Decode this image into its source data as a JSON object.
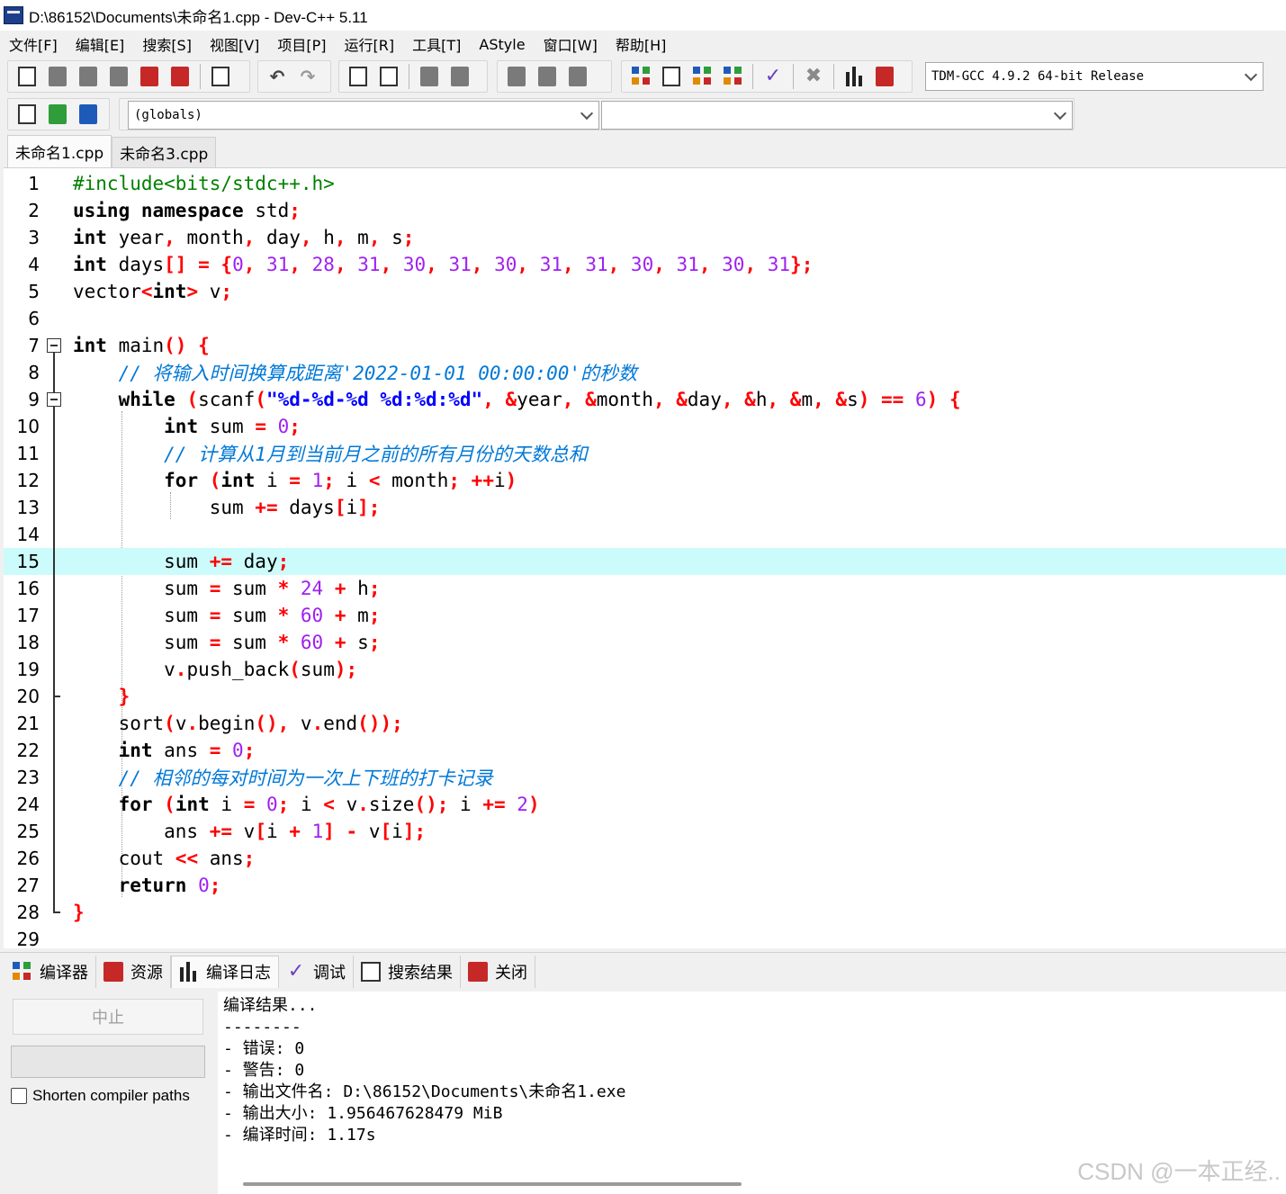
{
  "window": {
    "title": "D:\\86152\\Documents\\未命名1.cpp - Dev-C++ 5.11"
  },
  "menu": [
    "文件[F]",
    "编辑[E]",
    "搜索[S]",
    "视图[V]",
    "项目[P]",
    "运行[R]",
    "工具[T]",
    "AStyle",
    "窗口[W]",
    "帮助[H]"
  ],
  "toolbar": {
    "compiler_select": "TDM-GCC 4.9.2 64-bit Release",
    "scope_select": "(globals)",
    "member_select": ""
  },
  "tabs": [
    "未命名1.cpp",
    "未命名3.cpp"
  ],
  "editor": {
    "highlight_line": 15,
    "line_numbers": [
      "1",
      "2",
      "3",
      "4",
      "5",
      "6",
      "7",
      "8",
      "9",
      "10",
      "11",
      "12",
      "13",
      "14",
      "15",
      "16",
      "17",
      "18",
      "19",
      "20",
      "21",
      "22",
      "23",
      "24",
      "25",
      "26",
      "27",
      "28",
      "29"
    ]
  },
  "bottom_tabs": [
    "编译器",
    "资源",
    "编译日志",
    "调试",
    "搜索结果",
    "关闭"
  ],
  "bottom_panel": {
    "abort_label": "中止",
    "shorten_label": "Shorten compiler paths",
    "log": [
      "编译结果...",
      "--------",
      "- 错误: 0",
      "- 警告: 0",
      "- 输出文件名: D:\\86152\\Documents\\未命名1.exe",
      "- 输出大小: 1.956467628479 MiB",
      "- 编译时间: 1.17s"
    ]
  },
  "watermark": "CSDN @一本正经.."
}
